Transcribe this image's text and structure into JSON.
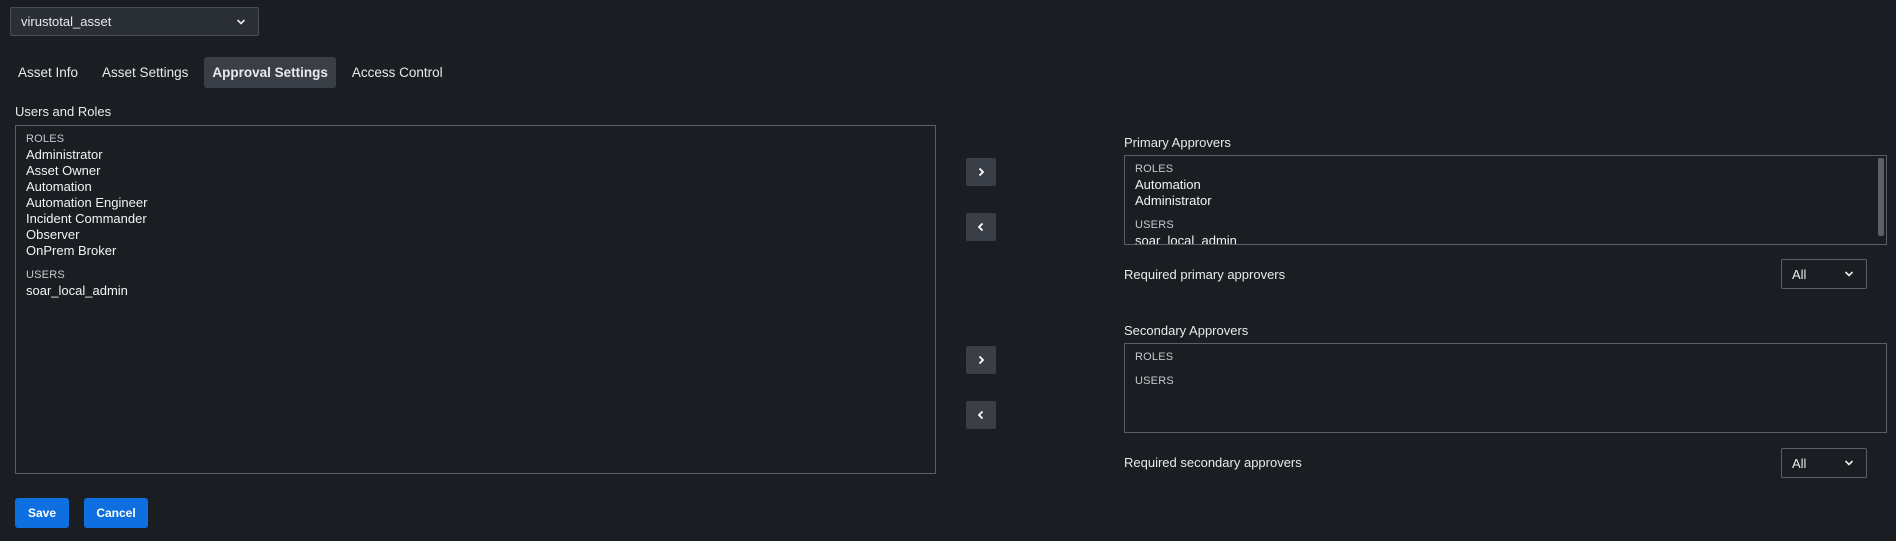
{
  "asset_select": {
    "value": "virustotal_asset",
    "icon": "chevron-down-icon"
  },
  "tabs": [
    {
      "label": "Asset Info",
      "active": false
    },
    {
      "label": "Asset Settings",
      "active": false
    },
    {
      "label": "Approval Settings",
      "active": true
    },
    {
      "label": "Access Control",
      "active": false
    }
  ],
  "users_and_roles": {
    "label": "Users and Roles",
    "roles_header": "ROLES",
    "roles": [
      "Administrator",
      "Asset Owner",
      "Automation",
      "Automation Engineer",
      "Incident Commander",
      "Observer",
      "OnPrem Broker"
    ],
    "users_header": "USERS",
    "users": [
      "soar_local_admin"
    ]
  },
  "primary_approvers": {
    "label": "Primary Approvers",
    "roles_header": "ROLES",
    "roles": [
      "Automation",
      "Administrator"
    ],
    "users_header": "USERS",
    "users": [
      "soar_local_admin"
    ],
    "required_label": "Required primary approvers",
    "required_value": "All"
  },
  "secondary_approvers": {
    "label": "Secondary Approvers",
    "roles_header": "ROLES",
    "roles": [],
    "users_header": "USERS",
    "users": [],
    "required_label": "Required secondary approvers",
    "required_value": "All"
  },
  "actions": {
    "save_label": "Save",
    "cancel_label": "Cancel"
  },
  "colors": {
    "background": "#1a1d21",
    "accent": "#0d6fe0",
    "button_gray": "#3a3f47"
  }
}
